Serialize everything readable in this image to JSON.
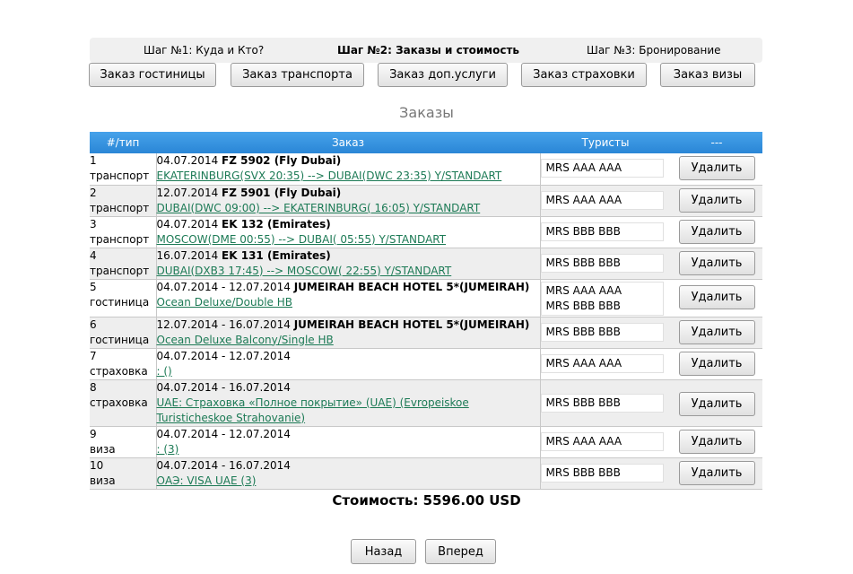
{
  "steps": [
    {
      "label": "Шаг №1: Куда и Кто?"
    },
    {
      "label": "Шаг №2: Заказы и стоимость"
    },
    {
      "label": "Шаг №3: Бронирование"
    }
  ],
  "tabs": [
    {
      "label": "Заказ гостиницы"
    },
    {
      "label": "Заказ транспорта"
    },
    {
      "label": "Заказ доп.услуги"
    },
    {
      "label": "Заказ страховки"
    },
    {
      "label": "Заказ визы"
    }
  ],
  "heading": "Заказы",
  "table": {
    "headers": [
      "#/тип",
      "Заказ",
      "Туристы",
      "---"
    ],
    "delete_label": "Удалить",
    "rows": [
      {
        "num": "1",
        "type": "транспорт",
        "date": "04.07.2014",
        "title": "FZ 5902 (Fly Dubai)",
        "link": "EKATERINBURG(SVX 20:35) --> DUBAI(DWC 23:35) Y/STANDART",
        "tourists": [
          "MRS AAA AAA"
        ]
      },
      {
        "num": "2",
        "type": "транспорт",
        "date": "12.07.2014",
        "title": "FZ 5901 (Fly Dubai)",
        "link": "DUBAI(DWC 09:00) --> EKATERINBURG( 16:05) Y/STANDART",
        "tourists": [
          "MRS AAA AAA"
        ]
      },
      {
        "num": "3",
        "type": "транспорт",
        "date": "04.07.2014",
        "title": "EK 132 (Emirates)",
        "link": "MOSCOW(DME 00:55) --> DUBAI( 05:55) Y/STANDART",
        "tourists": [
          "MRS BBB BBB"
        ]
      },
      {
        "num": "4",
        "type": "транспорт",
        "date": "16.07.2014",
        "title": "EK 131 (Emirates)",
        "link": "DUBAI(DXB3 17:45) --> MOSCOW( 22:55) Y/STANDART",
        "tourists": [
          "MRS BBB BBB"
        ]
      },
      {
        "num": "5",
        "type": "гостиница",
        "date": "04.07.2014 - 12.07.2014",
        "title": "JUMEIRAH BEACH HOTEL 5*(JUMEIRAH)",
        "link": "Ocean Deluxe/Double HB",
        "tourists": [
          "MRS AAA AAA",
          "MRS BBB BBB"
        ]
      },
      {
        "num": "6",
        "type": "гостиница",
        "date": "12.07.2014 - 16.07.2014",
        "title": "JUMEIRAH BEACH HOTEL 5*(JUMEIRAH)",
        "link": "Ocean Deluxe Balcony/Single HB",
        "tourists": [
          "MRS BBB BBB"
        ]
      },
      {
        "num": "7",
        "type": "страховка",
        "date": "04.07.2014 - 12.07.2014",
        "title": "",
        "link": ": ()",
        "tourists": [
          "MRS AAA AAA"
        ]
      },
      {
        "num": "8",
        "type": "страховка",
        "date": "04.07.2014 - 16.07.2014",
        "title": "",
        "link": "UAE: Страховка «Полное покрытие» (UAE) (Evropeiskoe Turisticheskoe Strahovanie)",
        "tourists": [
          "MRS BBB BBB"
        ]
      },
      {
        "num": "9",
        "type": "виза",
        "date": "04.07.2014 - 12.07.2014",
        "title": "",
        "link": ": (3)",
        "tourists": [
          "MRS AAA AAA"
        ]
      },
      {
        "num": "10",
        "type": "виза",
        "date": "04.07.2014 - 16.07.2014",
        "title": "",
        "link": "ОАЭ: VISA UAE (3)",
        "tourists": [
          "MRS BBB BBB"
        ]
      }
    ]
  },
  "total": "Стоимость: 5596.00 USD",
  "nav": {
    "back": "Назад",
    "forward": "Вперед"
  },
  "colors": {
    "header_blue": "#2a86d6",
    "link_green": "#1c7a55",
    "row_alt": "#eeeeee"
  }
}
